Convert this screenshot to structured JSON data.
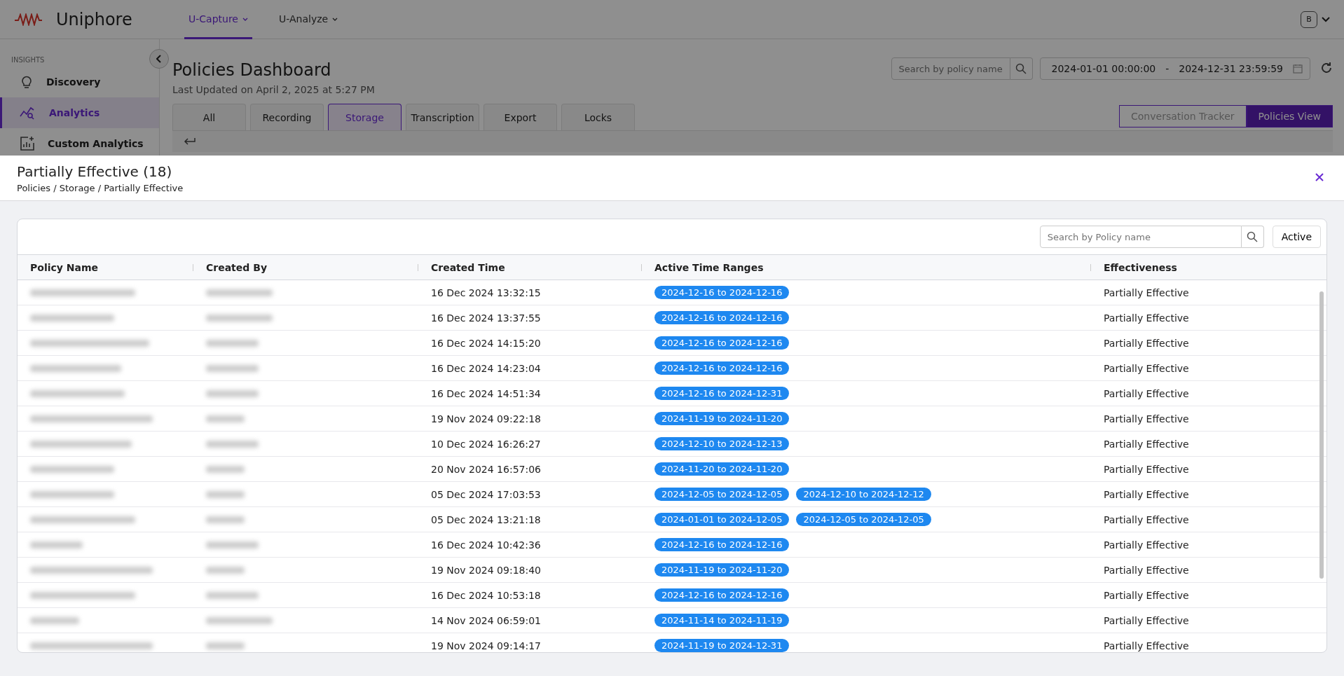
{
  "app": {
    "brand": "Uniphore",
    "nav": [
      {
        "label": "U-Capture",
        "selected": true
      },
      {
        "label": "U-Analyze",
        "selected": false
      }
    ],
    "avatar": "B"
  },
  "sidebar": {
    "section": "INSIGHTS",
    "items": [
      {
        "label": "Discovery",
        "kind": "bulb",
        "selected": false
      },
      {
        "label": "Analytics",
        "kind": "chart",
        "selected": true
      },
      {
        "label": "Custom Analytics",
        "kind": "custom",
        "selected": false
      }
    ]
  },
  "dashboard": {
    "title": "Policies Dashboard",
    "subtitle": "Last Updated on April 2, 2025 at 5:27 PM",
    "search": {
      "placeholder": "Search by policy name"
    },
    "date_from": "2024-01-01 00:00:00",
    "date_sep": "-",
    "date_to": "2024-12-31 23:59:59",
    "tabs": [
      {
        "label": "All",
        "selected": false
      },
      {
        "label": "Recording",
        "selected": false
      },
      {
        "label": "Storage",
        "selected": true
      },
      {
        "label": "Transcription",
        "selected": false
      },
      {
        "label": "Export",
        "selected": false
      },
      {
        "label": "Locks",
        "selected": false
      }
    ],
    "views": [
      {
        "label": "Conversation Tracker",
        "selected": false
      },
      {
        "label": "Policies View",
        "selected": true
      }
    ]
  },
  "modal": {
    "title": "Partially Effective (18)",
    "breadcrumb": "Policies / Storage / Partially Effective",
    "search": {
      "placeholder": "Search by Policy name"
    },
    "filter_button": "Active",
    "table": {
      "columns": [
        "Policy Name",
        "Created By",
        "Created Time",
        "Active Time Ranges",
        "Effectiveness"
      ],
      "rows": [
        {
          "created_time": "16 Dec 2024 13:32:15",
          "ranges": [
            "2024-12-16 to 2024-12-16"
          ],
          "effectiveness": "Partially Effective"
        },
        {
          "created_time": "16 Dec 2024 13:37:55",
          "ranges": [
            "2024-12-16 to 2024-12-16"
          ],
          "effectiveness": "Partially Effective"
        },
        {
          "created_time": "16 Dec 2024 14:15:20",
          "ranges": [
            "2024-12-16 to 2024-12-16"
          ],
          "effectiveness": "Partially Effective"
        },
        {
          "created_time": "16 Dec 2024 14:23:04",
          "ranges": [
            "2024-12-16 to 2024-12-16"
          ],
          "effectiveness": "Partially Effective"
        },
        {
          "created_time": "16 Dec 2024 14:51:34",
          "ranges": [
            "2024-12-16 to 2024-12-31"
          ],
          "effectiveness": "Partially Effective"
        },
        {
          "created_time": "19 Nov 2024 09:22:18",
          "ranges": [
            "2024-11-19 to 2024-11-20"
          ],
          "effectiveness": "Partially Effective"
        },
        {
          "created_time": "10 Dec 2024 16:26:27",
          "ranges": [
            "2024-12-10 to 2024-12-13"
          ],
          "effectiveness": "Partially Effective"
        },
        {
          "created_time": "20 Nov 2024 16:57:06",
          "ranges": [
            "2024-11-20 to 2024-11-20"
          ],
          "effectiveness": "Partially Effective"
        },
        {
          "created_time": "05 Dec 2024 17:03:53",
          "ranges": [
            "2024-12-05 to 2024-12-05",
            "2024-12-10 to 2024-12-12"
          ],
          "effectiveness": "Partially Effective"
        },
        {
          "created_time": "05 Dec 2024 13:21:18",
          "ranges": [
            "2024-01-01 to 2024-12-05",
            "2024-12-05 to 2024-12-05"
          ],
          "effectiveness": "Partially Effective"
        },
        {
          "created_time": "16 Dec 2024 10:42:36",
          "ranges": [
            "2024-12-16 to 2024-12-16"
          ],
          "effectiveness": "Partially Effective"
        },
        {
          "created_time": "19 Nov 2024 09:18:40",
          "ranges": [
            "2024-11-19 to 2024-11-20"
          ],
          "effectiveness": "Partially Effective"
        },
        {
          "created_time": "16 Dec 2024 10:53:18",
          "ranges": [
            "2024-12-16 to 2024-12-16"
          ],
          "effectiveness": "Partially Effective"
        },
        {
          "created_time": "14 Nov 2024 06:59:01",
          "ranges": [
            "2024-11-14 to 2024-11-19"
          ],
          "effectiveness": "Partially Effective"
        },
        {
          "created_time": "19 Nov 2024 09:14:17",
          "ranges": [
            "2024-11-19 to 2024-12-31"
          ],
          "effectiveness": "Partially Effective"
        }
      ]
    }
  }
}
